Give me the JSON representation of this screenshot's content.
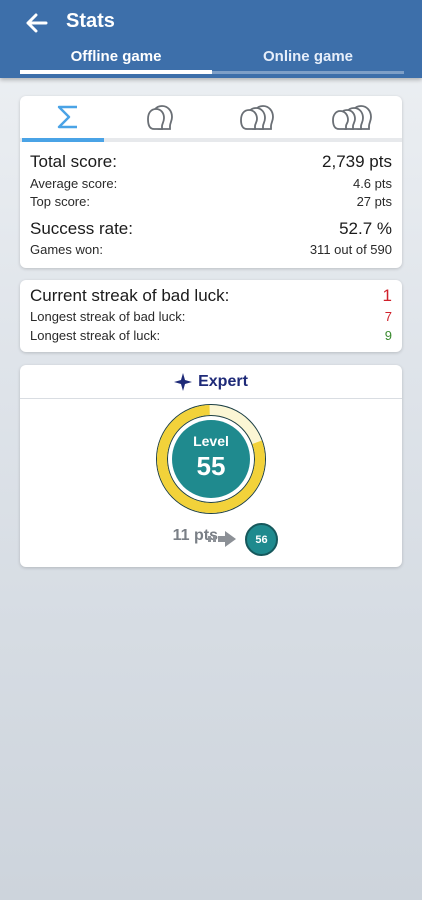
{
  "header": {
    "title": "Stats",
    "tabs": [
      {
        "label": "Offline game",
        "selected": true
      },
      {
        "label": "Online game",
        "selected": false
      }
    ]
  },
  "player_tabs": [
    {
      "icon": "sigma-icon",
      "selected": true
    },
    {
      "icon": "two-players-icon",
      "selected": false
    },
    {
      "icon": "three-players-icon",
      "selected": false
    },
    {
      "icon": "four-players-icon",
      "selected": false
    }
  ],
  "stats": {
    "total_score_label": "Total score:",
    "total_score_value": "2,739 pts",
    "average_score_label": "Average score:",
    "average_score_value": "4.6 pts",
    "top_score_label": "Top score:",
    "top_score_value": "27 pts",
    "success_rate_label": "Success rate:",
    "success_rate_value": "52.7 %",
    "games_won_label": "Games won:",
    "games_won_value": "311 out of 590"
  },
  "streaks": {
    "current_bad_label": "Current streak of bad luck:",
    "current_bad_value": "1",
    "longest_bad_label": "Longest streak of bad luck:",
    "longest_bad_value": "7",
    "longest_luck_label": "Longest streak of luck:",
    "longest_luck_value": "9"
  },
  "level": {
    "rank": "Expert",
    "level_label": "Level",
    "level_value": "55",
    "progress_fraction": 0.8,
    "points_to_next": "11 pts",
    "next_level": "56"
  },
  "colors": {
    "app_bar": "#3d6faa",
    "accent_tab": "#4aa3e6",
    "rank_text": "#1e2a78",
    "gauge_inner": "#1f8a8e",
    "gauge_progress": "#f2d23a",
    "gauge_remaining": "#1c5f63",
    "bad_luck": "#d0202a",
    "luck": "#3a8a2f"
  }
}
